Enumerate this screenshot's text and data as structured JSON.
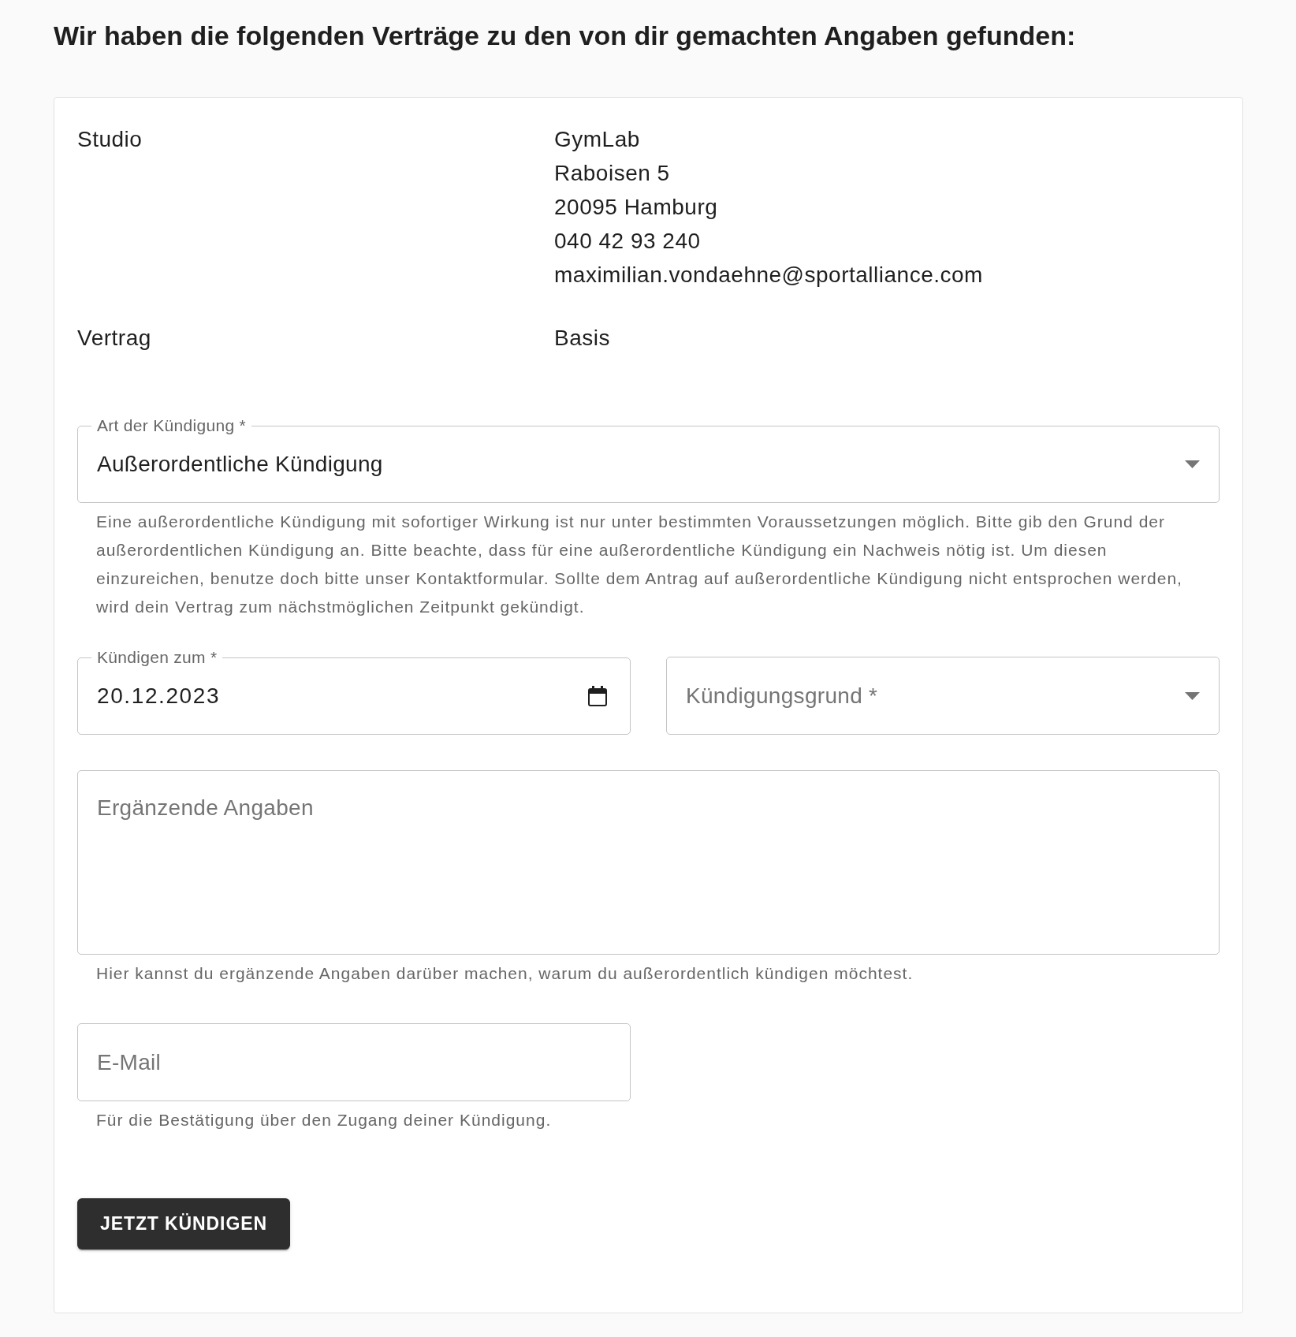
{
  "heading": "Wir haben die folgenden Verträge zu den von dir gemachten Angaben gefunden:",
  "contract": [
    {
      "label": "Studio",
      "lines": [
        "GymLab",
        "Raboisen 5",
        "20095 Hamburg",
        "040 42 93 240",
        "maximilian.vondaehne@sportalliance.com"
      ]
    },
    {
      "label": "Vertrag",
      "lines": [
        "Basis"
      ]
    }
  ],
  "form": {
    "fields": [
      {
        "kind": "select",
        "label": "Art der Kündigung *",
        "value": "Außerordentliche Kündigung",
        "helper": "Eine außerordentliche Kündigung mit sofortiger Wirkung ist nur unter bestimmten Voraussetzungen möglich. Bitte gib den Grund der außerordentlichen Kündigung an. Bitte beachte, dass für eine außerordentliche Kündigung ein Nachweis nötig ist. Um diesen einzureichen, benutze doch bitte unser Kontaktformular. Sollte dem Antrag auf außerordentliche Kündigung nicht entsprochen werden, wird dein Vertrag zum nächstmöglichen Zeitpunkt gekündigt."
      },
      {
        "kind": "date",
        "label": "Kündigen zum *",
        "value": "20.12.2023"
      },
      {
        "kind": "select",
        "placeholder": "Kündigungsgrund *"
      },
      {
        "kind": "textarea",
        "placeholder": "Ergänzende Angaben",
        "helper": "Hier kannst du ergänzende Angaben darüber machen, warum du außerordentlich kündigen möchtest."
      },
      {
        "kind": "email",
        "placeholder": "E-Mail",
        "helper": "Für die Bestätigung über den Zugang deiner Kündigung."
      }
    ],
    "submit_button": {
      "label": "JETZT KÜNDIGEN"
    }
  }
}
